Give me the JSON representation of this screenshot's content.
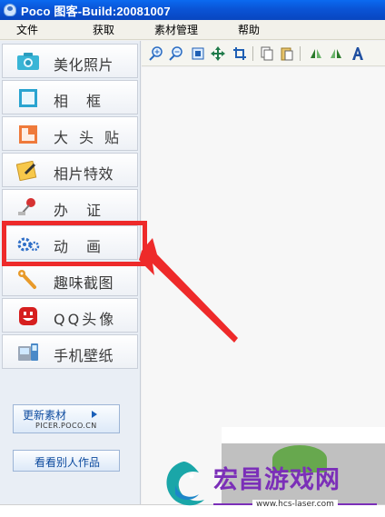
{
  "window": {
    "title": "Poco 图客-Build:20081007"
  },
  "menu": {
    "items": [
      {
        "label": "文件"
      },
      {
        "label": "获取"
      },
      {
        "label": "素材管理"
      },
      {
        "label": "帮助"
      }
    ]
  },
  "sidebar": {
    "items": [
      {
        "label": "美化照片",
        "icon": "camera-icon"
      },
      {
        "label": "相框",
        "icon": "frame-icon"
      },
      {
        "label": "大头贴",
        "icon": "sticker-icon"
      },
      {
        "label": "相片特效",
        "icon": "magic-wand-icon"
      },
      {
        "label": "办证",
        "icon": "pin-icon"
      },
      {
        "label": "动画",
        "icon": "gears-icon"
      },
      {
        "label": "趣味截图",
        "icon": "wrench-icon"
      },
      {
        "label": "QQ头像",
        "icon": "smiley-face-icon"
      },
      {
        "label": "手机壁纸",
        "icon": "mobile-phone-icon"
      }
    ],
    "update_button": {
      "label": "更新素材",
      "sublabel": "PICER.POCO.CN"
    },
    "works_button": {
      "label": "看看别人作品"
    }
  },
  "toolbar": {
    "icons": [
      "zoom-in-icon",
      "zoom-out-icon",
      "fit-window-icon",
      "move-icon",
      "crop-icon",
      "copy-icon",
      "paste-icon",
      "flip-left-icon",
      "flip-right-icon",
      "text-icon"
    ]
  },
  "annotation": {
    "highlight_color": "#ee2a2a"
  },
  "watermark": {
    "title": "宏昌游戏网",
    "url": "www.hcs-laser.com"
  }
}
